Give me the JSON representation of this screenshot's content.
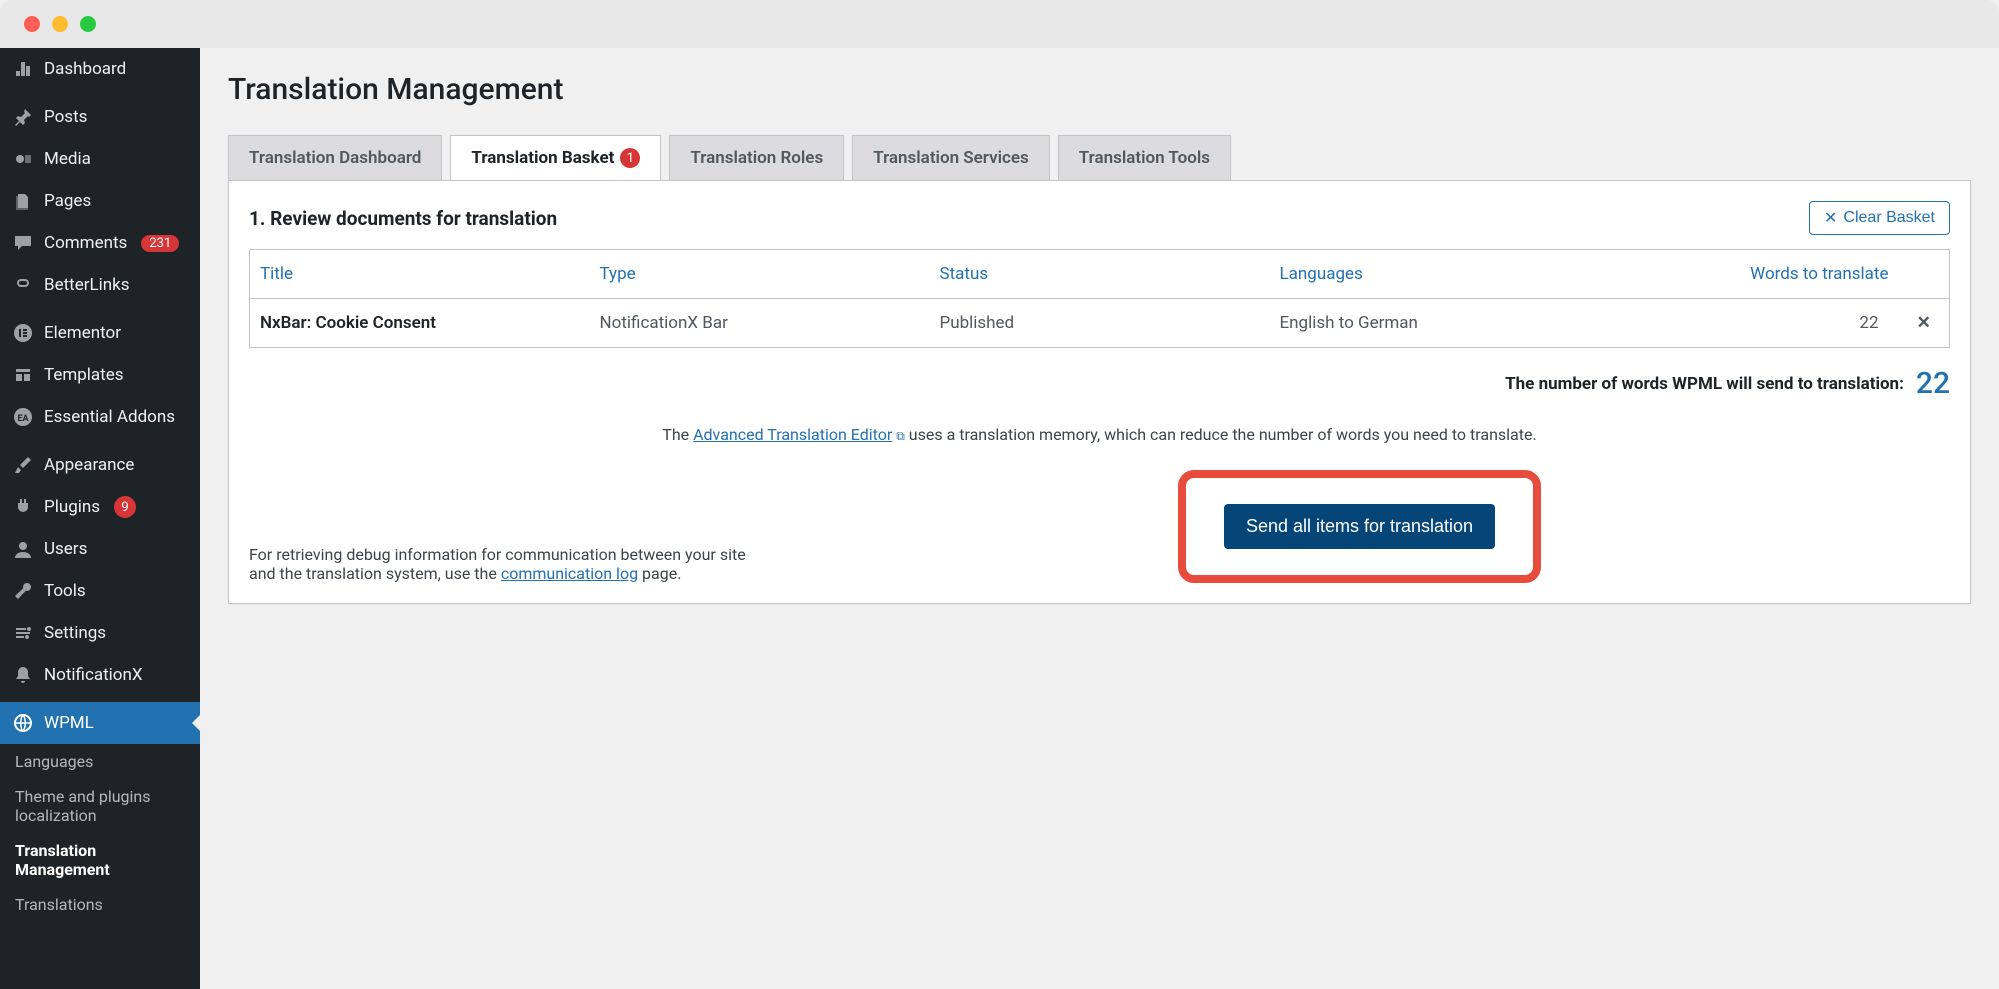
{
  "sidebar": {
    "items": [
      {
        "label": "Dashboard",
        "icon": "dashboard"
      },
      {
        "label": "Posts",
        "icon": "pin"
      },
      {
        "label": "Media",
        "icon": "media"
      },
      {
        "label": "Pages",
        "icon": "pages"
      },
      {
        "label": "Comments",
        "icon": "comment",
        "badge": "231"
      },
      {
        "label": "BetterLinks",
        "icon": "link"
      },
      {
        "label": "Elementor",
        "icon": "elementor"
      },
      {
        "label": "Templates",
        "icon": "templates"
      },
      {
        "label": "Essential Addons",
        "icon": "ea"
      },
      {
        "label": "Appearance",
        "icon": "brush"
      },
      {
        "label": "Plugins",
        "icon": "plug",
        "badge": "9"
      },
      {
        "label": "Users",
        "icon": "user"
      },
      {
        "label": "Tools",
        "icon": "wrench"
      },
      {
        "label": "Settings",
        "icon": "settings"
      },
      {
        "label": "NotificationX",
        "icon": "bell"
      },
      {
        "label": "WPML",
        "icon": "globe"
      }
    ],
    "subs": [
      {
        "label": "Languages"
      },
      {
        "label": "Theme and plugins localization"
      },
      {
        "label": "Translation Management"
      },
      {
        "label": "Translations"
      }
    ]
  },
  "page": {
    "title": "Translation Management",
    "tabs": [
      {
        "label": "Translation Dashboard"
      },
      {
        "label": "Translation Basket",
        "badge": "1"
      },
      {
        "label": "Translation Roles"
      },
      {
        "label": "Translation Services"
      },
      {
        "label": "Translation Tools"
      }
    ],
    "clear_label": "Clear Basket",
    "section_heading": "1. Review documents for translation",
    "table": {
      "headers": {
        "title": "Title",
        "type": "Type",
        "status": "Status",
        "languages": "Languages",
        "words": "Words to translate"
      },
      "rows": [
        {
          "title": "NxBar: Cookie Consent",
          "type": "NotificationX Bar",
          "status": "Published",
          "languages": "English to German",
          "words": "22"
        }
      ]
    },
    "words_line_prefix": "The number of words WPML will send to translation:",
    "words_total": "22",
    "memory_prefix": "The ",
    "memory_link": "Advanced Translation Editor",
    "memory_suffix": " uses a translation memory, which can reduce the number of words you need to translate.",
    "send_button": "Send all items for translation",
    "debug_prefix": "For retrieving debug information for communication between your site and the translation system, use the ",
    "debug_link": "communication log",
    "debug_suffix": " page."
  }
}
